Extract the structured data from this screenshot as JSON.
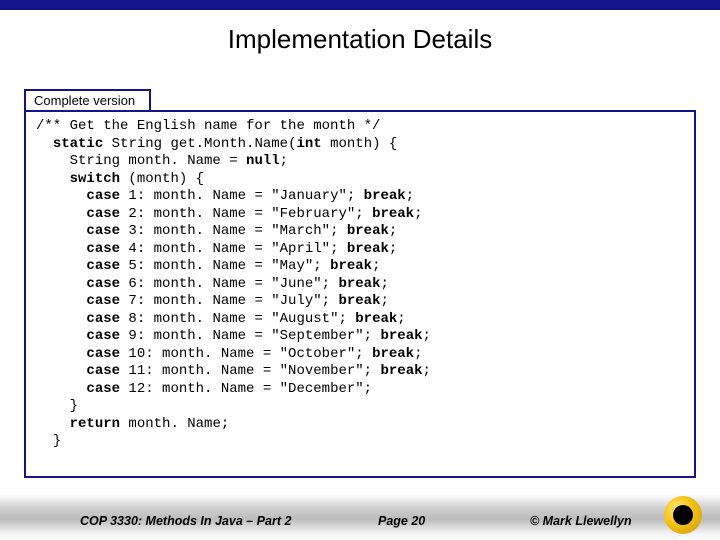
{
  "title": "Implementation Details",
  "label": "Complete version",
  "code": {
    "comment": "/** Get the English name for the month */",
    "decl_static": "static",
    "decl_rest": " String get.Month.Name(",
    "decl_int": "int",
    "decl_end": " month) {",
    "var_line_pre": "    String month. Name = ",
    "var_null": "null",
    "var_line_post": ";",
    "switch_kw": "switch",
    "switch_rest": " (month) {",
    "cases": [
      {
        "n": "1",
        "val": "\"January\"",
        "brk": true
      },
      {
        "n": "2",
        "val": "\"February\"",
        "brk": true
      },
      {
        "n": "3",
        "val": "\"March\"",
        "brk": true
      },
      {
        "n": "4",
        "val": "\"April\"",
        "brk": true
      },
      {
        "n": "5",
        "val": "\"May\"",
        "brk": true
      },
      {
        "n": "6",
        "val": "\"June\"",
        "brk": true
      },
      {
        "n": "7",
        "val": "\"July\"",
        "brk": true
      },
      {
        "n": "8",
        "val": "\"August\"",
        "brk": true
      },
      {
        "n": "9",
        "val": "\"September\"",
        "brk": true
      },
      {
        "n": "10",
        "val": "\"October\"",
        "brk": true
      },
      {
        "n": "11",
        "val": "\"November\"",
        "brk": true
      },
      {
        "n": "12",
        "val": "\"December\"",
        "brk": false
      }
    ],
    "close_brace": "    }",
    "return_kw": "return",
    "return_rest": " month. Name;",
    "end_brace": "  }"
  },
  "footer": {
    "left": "COP 3330: Methods In Java – Part 2",
    "mid": "Page 20",
    "right": "© Mark Llewellyn"
  }
}
